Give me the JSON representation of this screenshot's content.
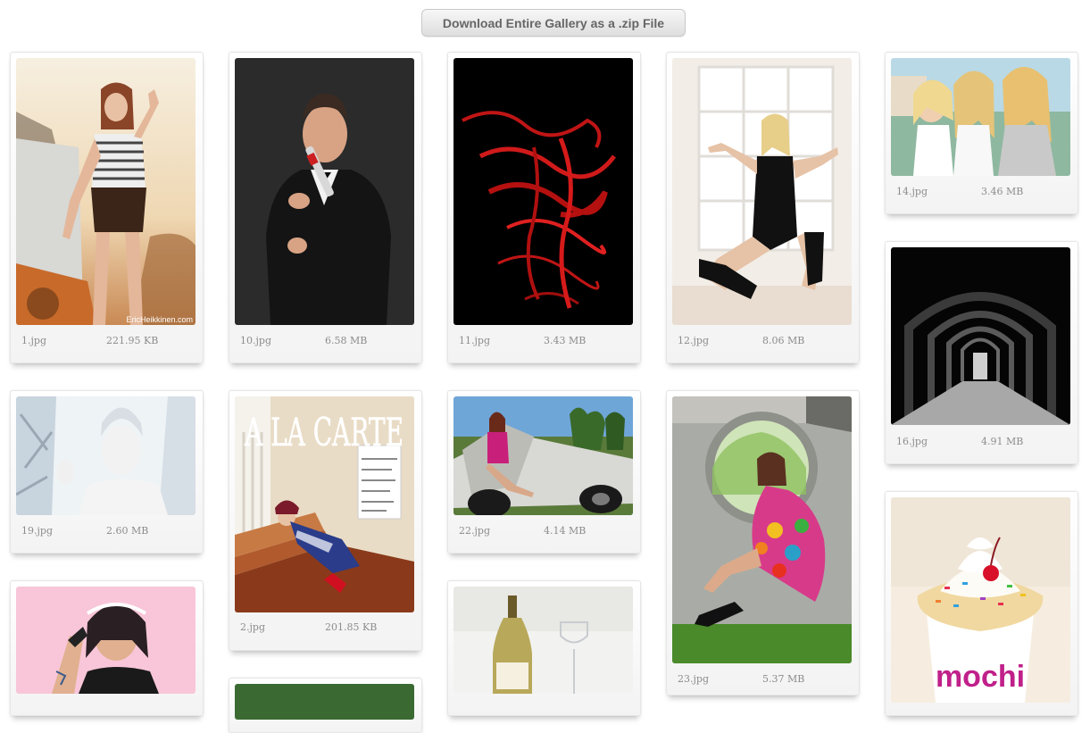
{
  "toolbar": {
    "download_label": "Download Entire Gallery as a .zip File"
  },
  "gallery": {
    "items": [
      {
        "name": "1.jpg",
        "size": "221.95 KB",
        "subject": "woman-on-tractor-photo",
        "watermark": "EricHeikkinen.com"
      },
      {
        "name": "10.jpg",
        "size": "6.58 MB",
        "subject": "man-in-tuxedo-with-flute-photo"
      },
      {
        "name": "11.jpg",
        "size": "3.43 MB",
        "subject": "red-light-painting-photo"
      },
      {
        "name": "12.jpg",
        "size": "8.06 MB",
        "subject": "dancer-by-window-photo"
      },
      {
        "name": "14.jpg",
        "size": "3.46 MB",
        "subject": "three-women-photo"
      },
      {
        "name": "16.jpg",
        "size": "4.91 MB",
        "subject": "arched-tunnel-photo"
      },
      {
        "name": "19.jpg",
        "size": "2.60 MB",
        "subject": "silver-portrait-photo"
      },
      {
        "name": "2.jpg",
        "size": "201.85 KB",
        "subject": "magazine-cover-photo",
        "cover_title": "A LA CARTE"
      },
      {
        "name": "22.jpg",
        "size": "4.14 MB",
        "subject": "woman-in-wrecked-car-photo"
      },
      {
        "name": "23.jpg",
        "size": "5.37 MB",
        "subject": "woman-in-circle-arch-photo"
      },
      {
        "subject": "tattooed-woman-photo"
      },
      {
        "subject": "wine-bottle-photo"
      },
      {
        "subject": "frozen-yogurt-cup-photo",
        "logo": "mochi"
      },
      {
        "subject": "green-photo-partial"
      }
    ]
  },
  "colors": {
    "button_text": "#666666",
    "meta_text": "#8c8c8c",
    "card_border": "#e6e6e6"
  }
}
